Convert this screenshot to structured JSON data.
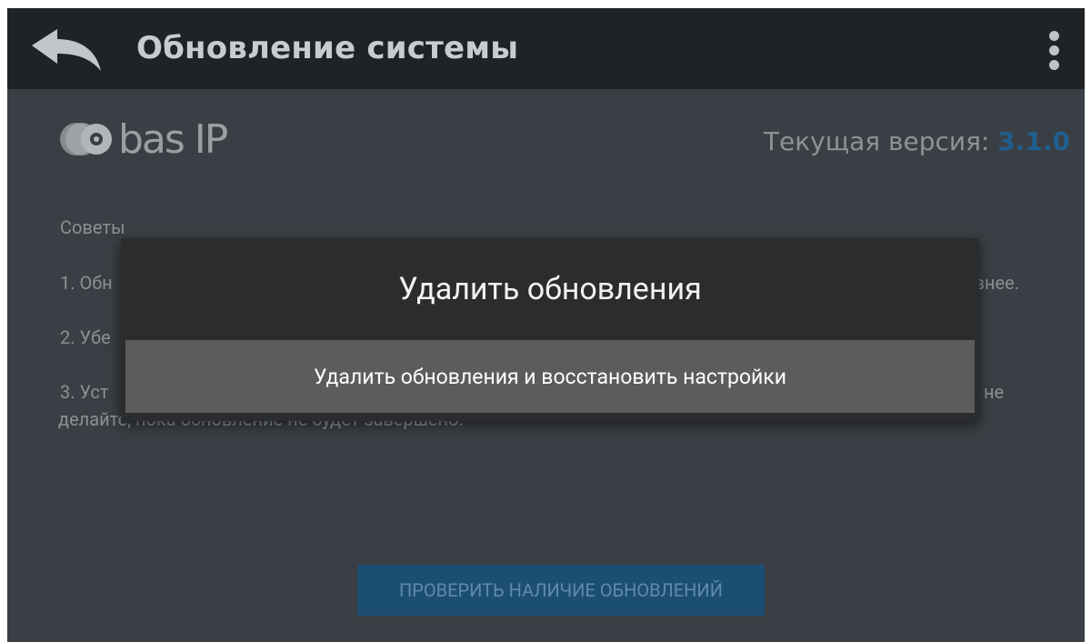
{
  "header": {
    "title": "Обновление системы",
    "back_icon": "back-arrow-icon",
    "menu_icon": "more-vertical-icon"
  },
  "brand": {
    "logo_text": "bas IP"
  },
  "version": {
    "label": "Текущая версия: ",
    "value": "3.1.0",
    "accent_color": "#1f5f8f"
  },
  "tips": {
    "title": "Советы",
    "item1_visible_start": "1. Обн",
    "item1_visible_end": "ивнее.",
    "item2_visible_start": "2. Убе",
    "item3_visible_start": "3. Уст",
    "item3_visible_end": "не",
    "item3_line2": "делайте, пока обновление не будет завершено."
  },
  "check_button": {
    "label": "ПРОВЕРИТЬ НАЛИЧИЕ ОБНОВЛЕНИЙ",
    "color": "#1c4e73"
  },
  "dialog": {
    "title": "Удалить обновления",
    "items": [
      {
        "label": "Удалить обновления и восстановить настройки"
      }
    ]
  }
}
